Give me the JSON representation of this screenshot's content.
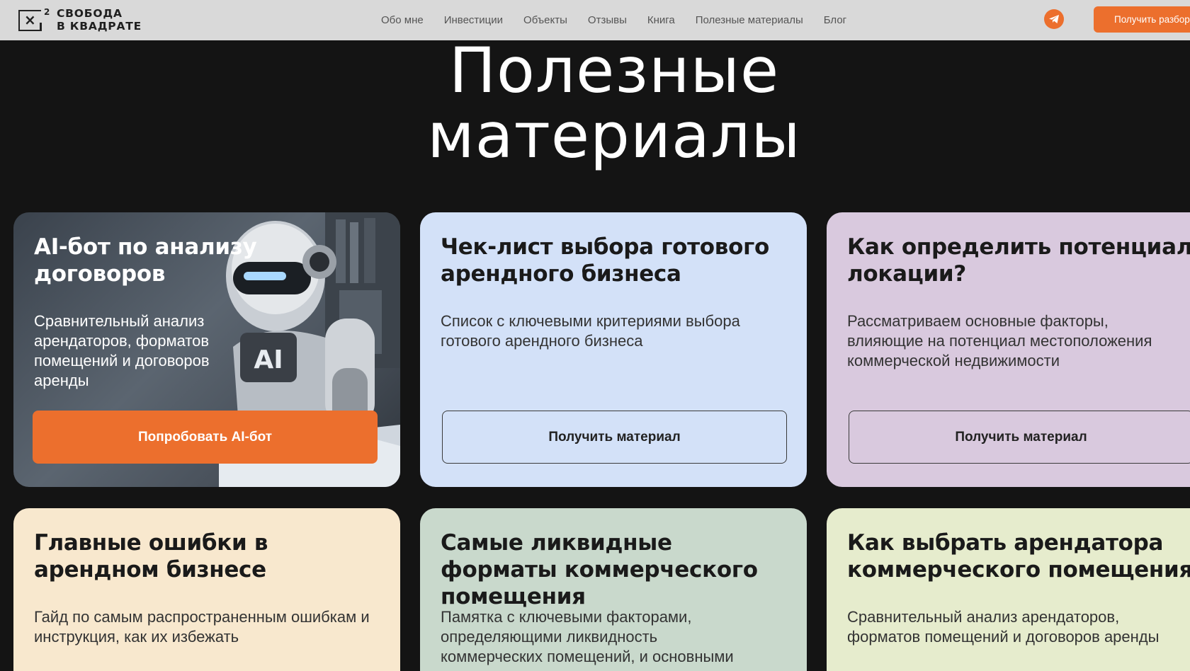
{
  "header": {
    "logo_line1": "СВОБОДА",
    "logo_line2": "В КВАДРАТЕ",
    "logo_mark": "X²",
    "nav": [
      "Обо мне",
      "Инвестиции",
      "Объекты",
      "Отзывы",
      "Книга",
      "Полезные материалы",
      "Блог"
    ],
    "telegram_icon": "telegram-icon",
    "cta_label": "Получить разбор"
  },
  "hero": {
    "title_line1": "Полезные",
    "title_line2": "материалы"
  },
  "cards": [
    {
      "title": "AI-бот по анализу договоров",
      "description": "Сравнительный анализ арендаторов, форматов помещений и договоров аренды",
      "button": "Попробовать AI-бот",
      "robot_badge": "AI"
    },
    {
      "title": "Чек-лист выбора готового арендного бизнеса",
      "description": "Список с ключевыми критериями выбора готового арендного бизнеса",
      "button": "Получить материал"
    },
    {
      "title": "Как определить потенциал локации?",
      "description": "Рассматриваем основные факторы, влияющие на потенциал местоположения коммерческой недвижимости",
      "button": "Получить материал"
    },
    {
      "title": "Главные ошибки в арендном бизнесе",
      "description": "Гайд по самым распространенным ошибкам и инструкция, как их избежать"
    },
    {
      "title": "Самые ликвидные форматы коммерческого помещения",
      "description": "Памятка с ключевыми факторами, определяющими ликвидность коммерческих помещений, и основными"
    },
    {
      "title": "Как выбрать арендатора коммерческого помещения",
      "description": "Сравнительный анализ арендаторов, форматов помещений и договоров аренды"
    }
  ],
  "colors": {
    "accent": "#ec6f2d",
    "background": "#141414",
    "header_bg": "#d9d9d9"
  }
}
